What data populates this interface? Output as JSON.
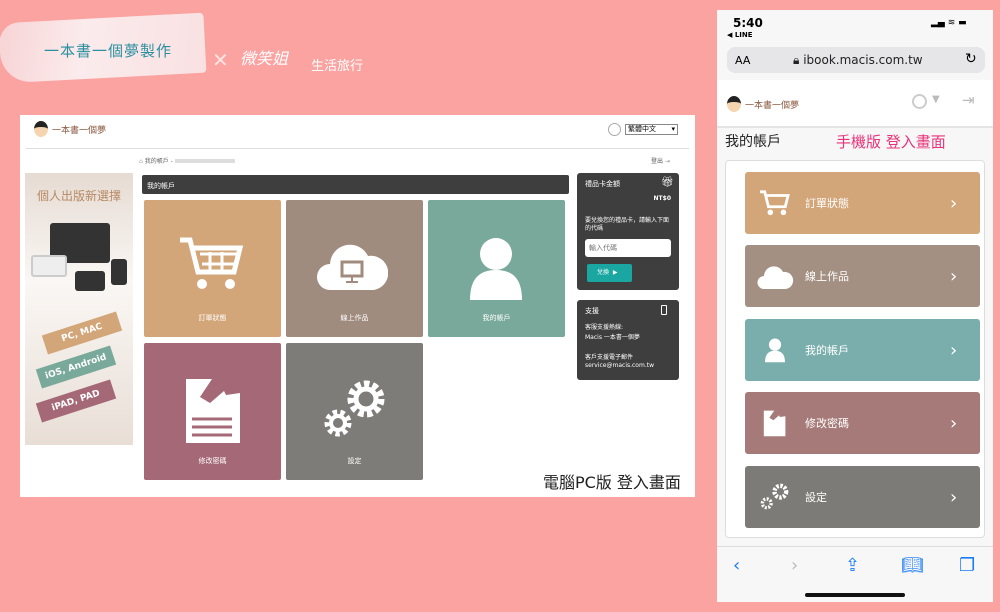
{
  "header": {
    "ribbon_text": "一本書一個夢製作",
    "cross": "✕",
    "signature": "微笑姐",
    "signature_sub": "生活旅行"
  },
  "pc": {
    "logo": "一本書一個夢",
    "language": "繁體中文",
    "breadcrumb": "我的帳戶 -",
    "logout": "登出",
    "section_title": "我的帳戶",
    "banner": {
      "title": "個人出版新選擇",
      "tags": [
        "PC, MAC",
        "iOS, Android",
        "iPAD, PAD"
      ]
    },
    "tiles": [
      {
        "label": "訂單狀態",
        "color": "#d3a67a"
      },
      {
        "label": "線上作品",
        "color": "#a08b7f"
      },
      {
        "label": "我的帳戶",
        "color": "#79a99a"
      },
      {
        "label": "修改密碼",
        "color": "#a56877"
      },
      {
        "label": "設定",
        "color": "#7e7c79"
      }
    ],
    "gift": {
      "title": "禮品卡金額",
      "amount": "NT$0",
      "desc": "要兌換您的禮品卡，請輸入下面的代碼",
      "placeholder": "輸入代碼",
      "button": "兌換"
    },
    "support": {
      "title": "支援",
      "line1": "客服支援熱線:",
      "line2": "Macis 一本書一個夢",
      "line3": "客戶支援電子郵件",
      "email": "service@macis.com.tw"
    },
    "caption": "電腦PC版 登入畫面"
  },
  "mobile": {
    "time": "5:40",
    "back_app": "◀ LINE",
    "aa": "AA",
    "url": "ibook.macis.com.tw",
    "logo": "一本書一個夢",
    "title": "我的帳戶",
    "caption": "手機版 登入畫面",
    "tiles": [
      {
        "label": "訂單狀態",
        "color": "#d3a67a"
      },
      {
        "label": "線上作品",
        "color": "#a39082"
      },
      {
        "label": "我的帳戶",
        "color": "#79aeac"
      },
      {
        "label": "修改密碼",
        "color": "#a67a78"
      },
      {
        "label": "設定",
        "color": "#7d7b77"
      }
    ]
  }
}
